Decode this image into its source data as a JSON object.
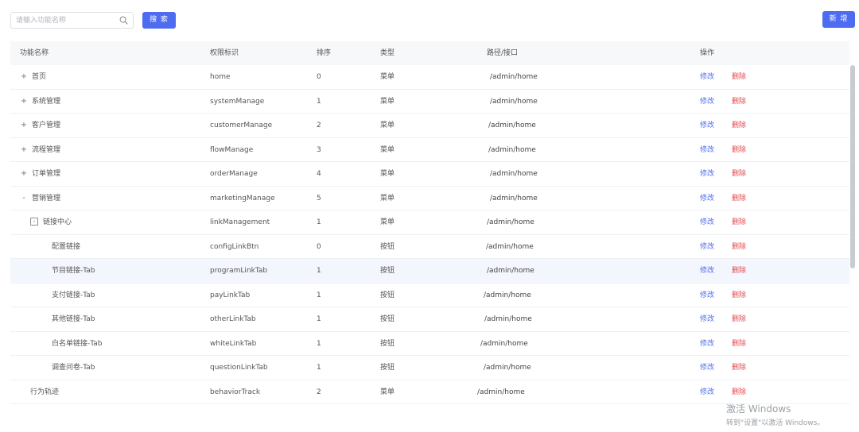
{
  "search": {
    "placeholder": "请输入功能名称",
    "button_label": "搜 索"
  },
  "toolbar": {
    "new_label": "新 增"
  },
  "columns": {
    "name": "功能名称",
    "permission": "权限标识",
    "sort": "排序",
    "type": "类型",
    "path": "路径/接口",
    "ops": "操作"
  },
  "actions": {
    "edit": "修改",
    "delete": "删除"
  },
  "rows": [
    {
      "name": "首页",
      "permission": "home",
      "sort": "0",
      "type": "菜单",
      "path": "/admin/home",
      "level": 0,
      "expander": "+"
    },
    {
      "name": "系统管理",
      "permission": "systemManage",
      "sort": "1",
      "type": "菜单",
      "path": "/admin/home",
      "level": 0,
      "expander": "+"
    },
    {
      "name": "客户管理",
      "permission": "customerManage",
      "sort": "2",
      "type": "菜单",
      "path": "/admin/home",
      "level": 0,
      "expander": "+"
    },
    {
      "name": "流程管理",
      "permission": "flowManage",
      "sort": "3",
      "type": "菜单",
      "path": "/admin/home",
      "level": 0,
      "expander": "+"
    },
    {
      "name": "订单管理",
      "permission": "orderManage",
      "sort": "4",
      "type": "菜单",
      "path": "/admin/home",
      "level": 0,
      "expander": "+"
    },
    {
      "name": "营销管理",
      "permission": "marketingManage",
      "sort": "5",
      "type": "菜单",
      "path": "/admin/home",
      "level": 0,
      "expander": "-"
    },
    {
      "name": "链接中心",
      "permission": "linkManagement",
      "sort": "1",
      "type": "菜单",
      "path": "/admin/home",
      "level": 1,
      "expander": "-"
    },
    {
      "name": "配置链接",
      "permission": "configLinkBtn",
      "sort": "0",
      "type": "按钮",
      "path": "/admin/home",
      "level": 2,
      "expander": ""
    },
    {
      "name": "节目链接-Tab",
      "permission": "programLinkTab",
      "sort": "1",
      "type": "按钮",
      "path": "/admin/home",
      "level": 2,
      "expander": "",
      "highlight": true
    },
    {
      "name": "支付链接-Tab",
      "permission": "payLinkTab",
      "sort": "1",
      "type": "按钮",
      "path": "/admin/home",
      "level": 2,
      "expander": ""
    },
    {
      "name": "其他链接-Tab",
      "permission": "otherLinkTab",
      "sort": "1",
      "type": "按钮",
      "path": "/admin/home",
      "level": 2,
      "expander": ""
    },
    {
      "name": "白名单链接-Tab",
      "permission": "whiteLinkTab",
      "sort": "1",
      "type": "按钮",
      "path": "/admin/home",
      "level": 2,
      "expander": ""
    },
    {
      "name": "调查问卷-Tab",
      "permission": "questionLinkTab",
      "sort": "1",
      "type": "按钮",
      "path": "/admin/home",
      "level": 2,
      "expander": ""
    },
    {
      "name": "行为轨迹",
      "permission": "behaviorTrack",
      "sort": "2",
      "type": "菜单",
      "path": "/admin/home",
      "level": 1,
      "expander": ""
    }
  ],
  "watermark": {
    "line1": "激活 Windows",
    "line2": "转到\"设置\"以激活 Windows。"
  }
}
